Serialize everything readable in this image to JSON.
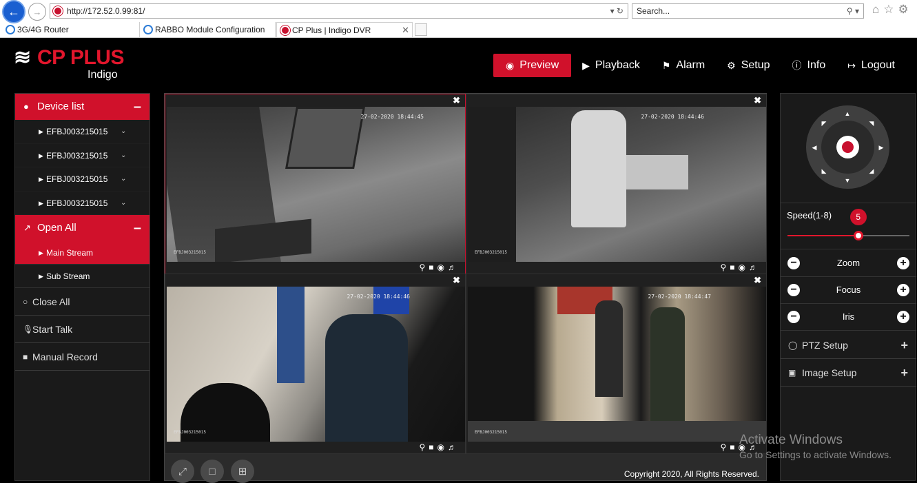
{
  "browser": {
    "url": "http://172.52.0.99:81/",
    "search_placeholder": "Search...",
    "tabs": [
      {
        "label": "3G/4G Router"
      },
      {
        "label": "RABBO Module Configuration"
      },
      {
        "label": "CP Plus | Indigo DVR"
      }
    ]
  },
  "app": {
    "brand": "CP PLUS",
    "product": "Indigo",
    "nav": [
      {
        "label": "Preview",
        "icon": "eye-icon"
      },
      {
        "label": "Playback",
        "icon": "play-icon"
      },
      {
        "label": "Alarm",
        "icon": "bell-icon"
      },
      {
        "label": "Setup",
        "icon": "gear-icon"
      },
      {
        "label": "Info",
        "icon": "info-icon"
      },
      {
        "label": "Logout",
        "icon": "logout-icon"
      }
    ]
  },
  "sidebar": {
    "device_list_label": "Device list",
    "devices": [
      "EFBJ003215015",
      "EFBJ003215015",
      "EFBJ003215015",
      "EFBJ003215015"
    ],
    "open_all_label": "Open All",
    "streams": [
      "Main Stream",
      "Sub Stream"
    ],
    "close_all_label": "Close All",
    "start_talk_label": "Start Talk",
    "manual_record_label": "Manual Record"
  },
  "video": {
    "cells": [
      {
        "osd": "27-02-2020 18:44:45",
        "name": "EFBJ003215015"
      },
      {
        "osd": "27-02-2020 18:44:46",
        "name": "EFBJ003215015"
      },
      {
        "osd": "27-02-2020 18:44:46",
        "name": "EFBJ003215015"
      },
      {
        "osd": "27-02-2020 18:44:47",
        "name": "EFBJ003215015"
      }
    ],
    "copyright": "Copyright 2020, All Rights Reserved."
  },
  "ptz": {
    "speed_label": "Speed(1-8)",
    "speed_value": "5",
    "speed_fraction": 0.58,
    "controls": [
      "Zoom",
      "Focus",
      "Iris"
    ],
    "ptz_setup_label": "PTZ Setup",
    "image_setup_label": "Image Setup"
  },
  "watermark": {
    "line1": "Activate Windows",
    "line2": "Go to Settings to activate Windows."
  },
  "colors": {
    "accent": "#d0112b",
    "background": "#000000"
  }
}
